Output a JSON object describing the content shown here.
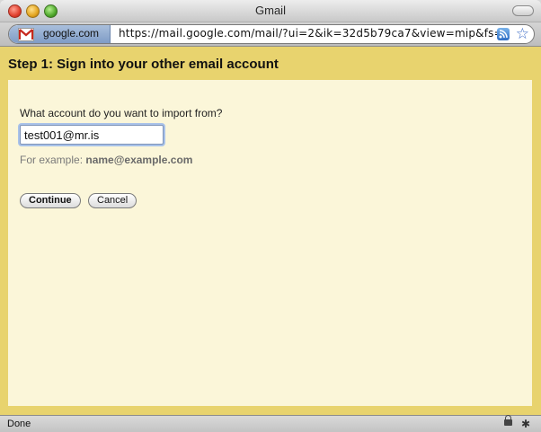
{
  "window": {
    "title": "Gmail"
  },
  "address_bar": {
    "site": "google.com",
    "url": "https://mail.google.com/mail/?ui=2&ik=32d5b79ca7&view=mip&fs="
  },
  "page": {
    "step_title": "Step 1: Sign into your other email account",
    "question": "What account do you want to import from?",
    "email_value": "test001@mr.is",
    "example_prefix": "For example: ",
    "example_value": "name@example.com",
    "continue_label": "Continue",
    "cancel_label": "Cancel"
  },
  "status_bar": {
    "text": "Done"
  },
  "icons": {
    "close": "close-icon",
    "minimize": "minimize-icon",
    "maximize": "maximize-icon",
    "gmail": "gmail-icon",
    "rss": "rss-icon",
    "bookmark": "star-icon",
    "lock": "lock-icon",
    "bug": "bug-icon"
  },
  "colors": {
    "header_bg": "#e8d36e",
    "panel_bg": "#fbf6d9"
  }
}
